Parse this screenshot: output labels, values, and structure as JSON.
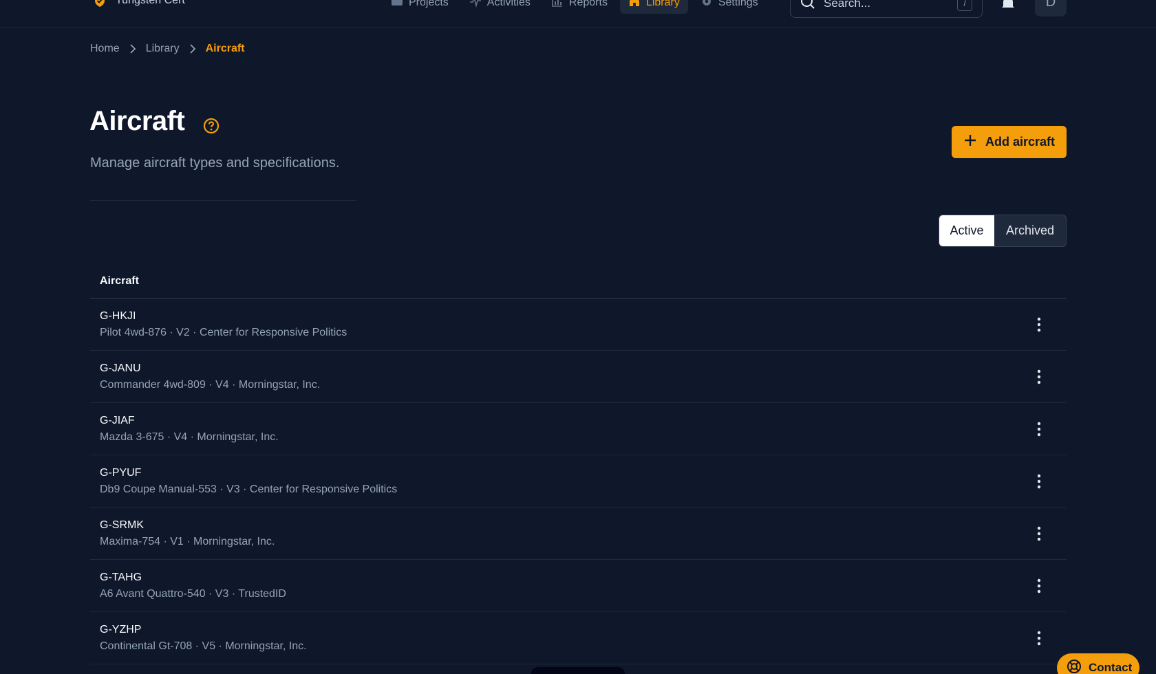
{
  "brand": {
    "name": "Tungsten Cert"
  },
  "nav": {
    "items": [
      {
        "label": "Projects",
        "icon": "folder-icon",
        "active": false
      },
      {
        "label": "Activities",
        "icon": "activity-icon",
        "active": false
      },
      {
        "label": "Reports",
        "icon": "bar-chart-icon",
        "active": false
      },
      {
        "label": "Library",
        "icon": "library-icon",
        "active": true
      },
      {
        "label": "Settings",
        "icon": "gear-icon",
        "active": false
      }
    ]
  },
  "search": {
    "placeholder": "Search...",
    "shortcut": "/"
  },
  "user": {
    "initial": "D"
  },
  "breadcrumb": {
    "home": "Home",
    "library": "Library",
    "current": "Aircraft"
  },
  "header": {
    "title": "Aircraft",
    "subtitle": "Manage aircraft types and specifications.",
    "add_label": "Add aircraft"
  },
  "filter": {
    "active_label": "Active",
    "archived_label": "Archived"
  },
  "table": {
    "column": "Aircraft",
    "rows": [
      {
        "reg": "G-HKJI",
        "desc": "Pilot 4wd-876 · V2 · Center for Responsive Politics"
      },
      {
        "reg": "G-JANU",
        "desc": "Commander 4wd-809 · V4 · Morningstar, Inc."
      },
      {
        "reg": "G-JIAF",
        "desc": "Mazda 3-675 · V4 · Morningstar, Inc."
      },
      {
        "reg": "G-PYUF",
        "desc": "Db9 Coupe Manual-553 · V3 · Center for Responsive Politics"
      },
      {
        "reg": "G-SRMK",
        "desc": "Maxima-754 · V1 · Morningstar, Inc."
      },
      {
        "reg": "G-TAHG",
        "desc": "A6 Avant Quattro-540 · V3 · TrustedID"
      },
      {
        "reg": "G-YZHP",
        "desc": "Continental Gt-708 · V5 · Morningstar, Inc."
      }
    ]
  },
  "contact": {
    "label": "Contact"
  },
  "colors": {
    "accent": "#f59e0b",
    "background": "#0f172a",
    "muted": "#94a3b8"
  }
}
